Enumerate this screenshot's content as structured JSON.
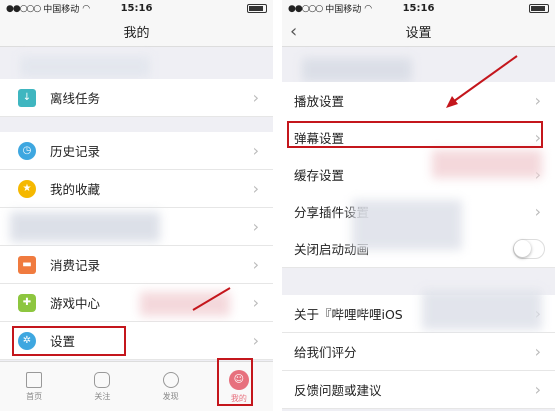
{
  "left": {
    "status": {
      "signal": "●●○○○",
      "carrier": "中国移动",
      "time": "15:16"
    },
    "title": "我的",
    "items": [
      {
        "label": "离线任务",
        "icon": "download-icon",
        "color": "#3fb6c0"
      },
      {
        "label": "历史记录",
        "icon": "clock-icon",
        "color": "#3ea7e0"
      },
      {
        "label": "我的收藏",
        "icon": "star-icon",
        "color": "#f5b800"
      },
      {
        "label": "消费记录",
        "icon": "wallet-icon",
        "color": "#f07b3f"
      },
      {
        "label": "游戏中心",
        "icon": "gamepad-icon",
        "color": "#8dc63f"
      },
      {
        "label": "设置",
        "icon": "gear-icon",
        "color": "#3ea7e0"
      }
    ],
    "tabs": [
      {
        "label": "首页",
        "icon": "home-icon"
      },
      {
        "label": "关注",
        "icon": "follow-icon"
      },
      {
        "label": "发现",
        "icon": "search-icon"
      },
      {
        "label": "我的",
        "icon": "profile-icon"
      }
    ]
  },
  "right": {
    "status": {
      "signal": "●●○○○",
      "carrier": "中国移动",
      "time": "15:16"
    },
    "title": "设置",
    "items": [
      {
        "label": "播放设置"
      },
      {
        "label": "弹幕设置"
      },
      {
        "label": "缓存设置"
      },
      {
        "label": "分享插件设置"
      },
      {
        "label": "关闭启动动画"
      },
      {
        "label": "关于『哔哩哔哩iOS"
      },
      {
        "label": "给我们评分"
      },
      {
        "label": "反馈问题或建议"
      }
    ]
  },
  "colors": {
    "highlight": "#c4161c",
    "active_tab": "#e7707d"
  }
}
